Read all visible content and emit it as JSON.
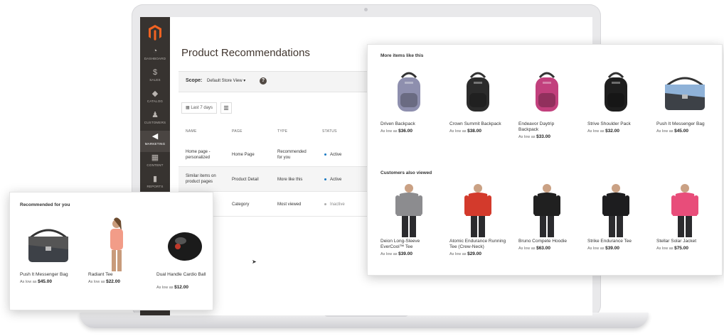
{
  "admin": {
    "nav": [
      {
        "icon": "dashboard-icon",
        "label": "DASHBOARD",
        "glyph": "◔"
      },
      {
        "icon": "dollar-icon",
        "label": "SALES",
        "glyph": "$"
      },
      {
        "icon": "cube-icon",
        "label": "CATALOG",
        "glyph": "◆"
      },
      {
        "icon": "person-icon",
        "label": "CUSTOMERS",
        "glyph": "♟"
      },
      {
        "icon": "megaphone-icon",
        "label": "MARKETING",
        "glyph": "◀"
      },
      {
        "icon": "content-icon",
        "label": "CONTENT",
        "glyph": "▦"
      },
      {
        "icon": "bar-chart-icon",
        "label": "REPORTS",
        "glyph": "▮"
      }
    ],
    "page_title": "Product Recommendations",
    "scope_label": "Scope:",
    "scope_value": "Default Store View ▾",
    "help": "?",
    "date_filter": "Last 7 days",
    "columns": [
      "NAME",
      "PAGE",
      "TYPE",
      "STATUS"
    ],
    "rows": [
      {
        "name": "Home page - personalized",
        "page": "Home Page",
        "type": "Recommended for you",
        "status": "Active"
      },
      {
        "name": "Similar items on product pages",
        "page": "Product Detail",
        "type": "More like this",
        "status": "Active"
      },
      {
        "name": "",
        "page": "Category",
        "type": "Most viewed",
        "status": "Inactive"
      }
    ],
    "colors": {
      "sidebar": "#373330",
      "active_dot": "#1979c3",
      "inactive_dot": "#adadad"
    }
  },
  "recommended": {
    "heading": "Recommended for you",
    "products": [
      {
        "name": "Push It Messenger Bag",
        "prefix": "As low as",
        "price": "$45.00",
        "image": "messenger-bag-icon"
      },
      {
        "name": "Radiant Tee",
        "prefix": "As low as",
        "price": "$22.00",
        "image": "woman-tee-icon"
      },
      {
        "name": "Dual Handle Cardio Ball",
        "prefix": "As low as",
        "price": "$12.00",
        "image": "cardio-ball-icon"
      }
    ]
  },
  "more_like_this": {
    "heading": "More items like this",
    "products": [
      {
        "name": "Driven Backpack",
        "prefix": "As low as",
        "price": "$36.00",
        "image": "backpack-icon",
        "color": "#8e8fae"
      },
      {
        "name": "Crown Summit Backpack",
        "prefix": "As low as",
        "price": "$38.00",
        "image": "backpack-icon",
        "color": "#2b2b2b"
      },
      {
        "name": "Endeavor Daytrip Backpack",
        "prefix": "As low as",
        "price": "$33.00",
        "image": "backpack-icon",
        "color": "#c2407d"
      },
      {
        "name": "Strive Shoulder Pack",
        "prefix": "As low as",
        "price": "$32.00",
        "image": "backpack-icon",
        "color": "#1e1e1e"
      },
      {
        "name": "Push It Messenger Bag",
        "prefix": "As low as",
        "price": "$45.00",
        "image": "messenger-bag-icon",
        "color": "#8fb2d8"
      }
    ]
  },
  "also_viewed": {
    "heading": "Customers also viewed",
    "products": [
      {
        "name": "Deion Long-Sleeve EverCool™ Tee",
        "prefix": "As low as",
        "price": "$39.00",
        "image": "man-shirt-icon",
        "color": "#8c8c8f"
      },
      {
        "name": "Atomic Endurance Running Tee (Crew-Neck)",
        "prefix": "As low as",
        "price": "$29.00",
        "image": "man-shirt-icon",
        "color": "#d33a2c"
      },
      {
        "name": "Bruno Compete Hoodie",
        "prefix": "As low as",
        "price": "$63.00",
        "image": "man-hoodie-icon",
        "color": "#202020"
      },
      {
        "name": "Strike Endurance Tee",
        "prefix": "As low as",
        "price": "$39.00",
        "image": "man-shirt-icon",
        "color": "#1d1d1f"
      },
      {
        "name": "Stellar Solar Jacket",
        "prefix": "As low as",
        "price": "$75.00",
        "image": "woman-jacket-icon",
        "color": "#e84d7a"
      }
    ]
  }
}
